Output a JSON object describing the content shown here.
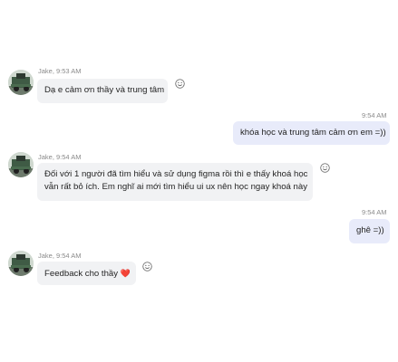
{
  "messages": [
    {
      "sender": "Jake",
      "time": "9:53 AM",
      "meta": "Jake, 9:53 AM",
      "text": "Dạ e cảm ơn thầy và trung tâm"
    },
    {
      "time": "9:54 AM",
      "text": "khóa học và trung tâm cảm ơn em =))"
    },
    {
      "sender": "Jake",
      "time": "9:54 AM",
      "meta": "Jake, 9:54 AM",
      "lines": [
        "Đối với 1 người đã tìm hiểu và sử dụng figma rồi thì e thấy khoá học",
        "vẫn rất bỏ ích. Em nghĩ ai mới tìm hiểu ui ux nên học ngay khoá này"
      ]
    },
    {
      "time": "9:54 AM",
      "text": "ghê =))"
    },
    {
      "sender": "Jake",
      "time": "9:54 AM",
      "meta": "Jake, 9:54 AM",
      "text": "Feedback cho thầy",
      "emoji": "❤️"
    }
  ],
  "icons": {
    "reaction": "smiley-reaction-icon",
    "heart": "heart-emoji-icon"
  },
  "colors": {
    "incoming_bubble": "#f1f2f4",
    "outgoing_bubble": "#e8ebfa",
    "meta_text": "#8a8a8a",
    "heart": "#d13438"
  }
}
